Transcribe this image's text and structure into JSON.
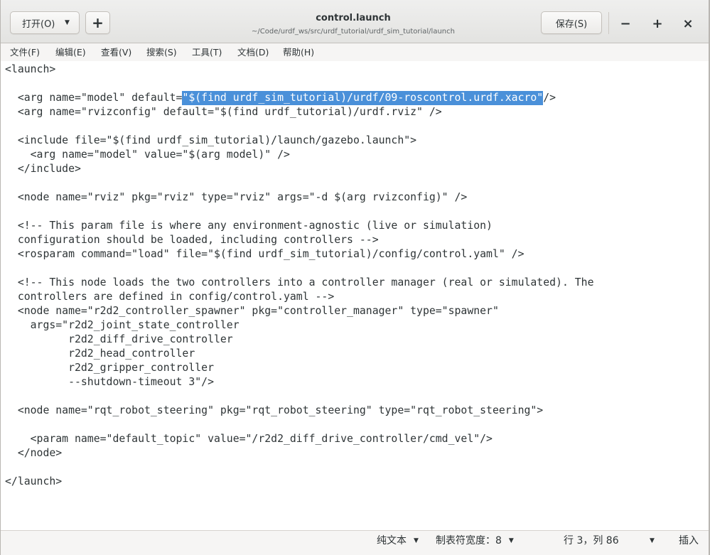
{
  "window": {
    "title": "control.launch",
    "subtitle": "~/Code/urdf_ws/src/urdf_tutorial/urdf_sim_tutorial/launch"
  },
  "header": {
    "open_label": "打开(O)",
    "new_tab": {
      "icon": "plus-icon",
      "glyph": "+"
    },
    "save_label": "保存(S)"
  },
  "window_controls": {
    "minimize": {
      "icon": "minimize-icon",
      "glyph": "−"
    },
    "maximize": {
      "icon": "maximize-icon",
      "glyph": "+"
    },
    "close": {
      "icon": "close-icon",
      "glyph": "×"
    }
  },
  "icons": {
    "dropdown": {
      "icon": "chevron-down-icon",
      "glyph": "▼"
    }
  },
  "menu": {
    "items": [
      "文件(F)",
      "编辑(E)",
      "查看(V)",
      "搜索(S)",
      "工具(T)",
      "文档(D)",
      "帮助(H)"
    ]
  },
  "editor": {
    "lines": [
      "<launch>",
      "",
      {
        "before": "  <arg name=\"model\" default=",
        "selected": "\"$(find urdf_sim_tutorial)/urdf/09-roscontrol.urdf.xacro\"",
        "after": "/>"
      },
      "  <arg name=\"rvizconfig\" default=\"$(find urdf_tutorial)/urdf.rviz\" />",
      "",
      "  <include file=\"$(find urdf_sim_tutorial)/launch/gazebo.launch\">",
      "    <arg name=\"model\" value=\"$(arg model)\" />",
      "  </include>",
      "",
      "  <node name=\"rviz\" pkg=\"rviz\" type=\"rviz\" args=\"-d $(arg rvizconfig)\" />",
      "",
      "  <!-- This param file is where any environment-agnostic (live or simulation)",
      "  configuration should be loaded, including controllers -->",
      "  <rosparam command=\"load\" file=\"$(find urdf_sim_tutorial)/config/control.yaml\" />",
      "",
      "  <!-- This node loads the two controllers into a controller manager (real or simulated). The",
      "  controllers are defined in config/control.yaml -->",
      "  <node name=\"r2d2_controller_spawner\" pkg=\"controller_manager\" type=\"spawner\"",
      "    args=\"r2d2_joint_state_controller",
      "          r2d2_diff_drive_controller",
      "          r2d2_head_controller",
      "          r2d2_gripper_controller",
      "          --shutdown-timeout 3\"/>",
      "",
      "  <node name=\"rqt_robot_steering\" pkg=\"rqt_robot_steering\" type=\"rqt_robot_steering\">",
      "",
      "    <param name=\"default_topic\" value=\"/r2d2_diff_drive_controller/cmd_vel\"/>",
      "  </node>",
      "",
      "</launch>"
    ]
  },
  "status": {
    "language": "纯文本",
    "tab_width": "制表符宽度：8",
    "cursor_position": "行 3，列 86",
    "insert_mode": "插入"
  },
  "colors": {
    "selection": "#4a90d9",
    "selection_text": "#ffffff",
    "text": "#2e3436"
  }
}
